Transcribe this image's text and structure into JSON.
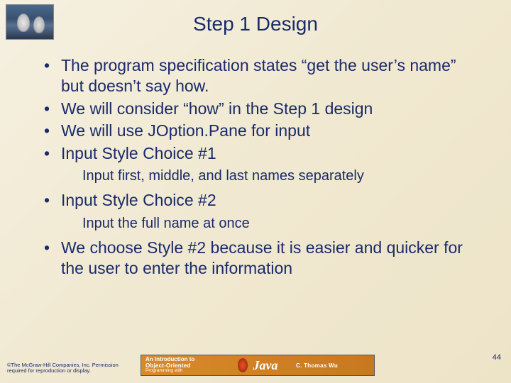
{
  "title": "Step 1 Design",
  "bullets": [
    {
      "level": 1,
      "text": "The program specification states “get the user’s name” but doesn’t say how."
    },
    {
      "level": 1,
      "text": "We will consider “how” in the Step 1 design"
    },
    {
      "level": 1,
      "text": "We will use JOption.Pane for input"
    },
    {
      "level": 1,
      "text": "Input Style Choice #1"
    },
    {
      "level": 2,
      "text": "Input first, middle, and last names separately"
    },
    {
      "level": 1,
      "text": "Input Style Choice #2"
    },
    {
      "level": 2,
      "text": "Input the full name at once"
    },
    {
      "level": 1,
      "text": "We choose Style #2 because it is easier and quicker for the user to enter the information"
    }
  ],
  "copyright": "©The McGraw-Hill Companies, Inc. Permission required for reproduction or display.",
  "banner": {
    "line1": "An Introduction to",
    "line2": "Object-Oriented",
    "line3": "Programming with",
    "logo": "Java",
    "author": "C. Thomas Wu"
  },
  "page_number": "44"
}
